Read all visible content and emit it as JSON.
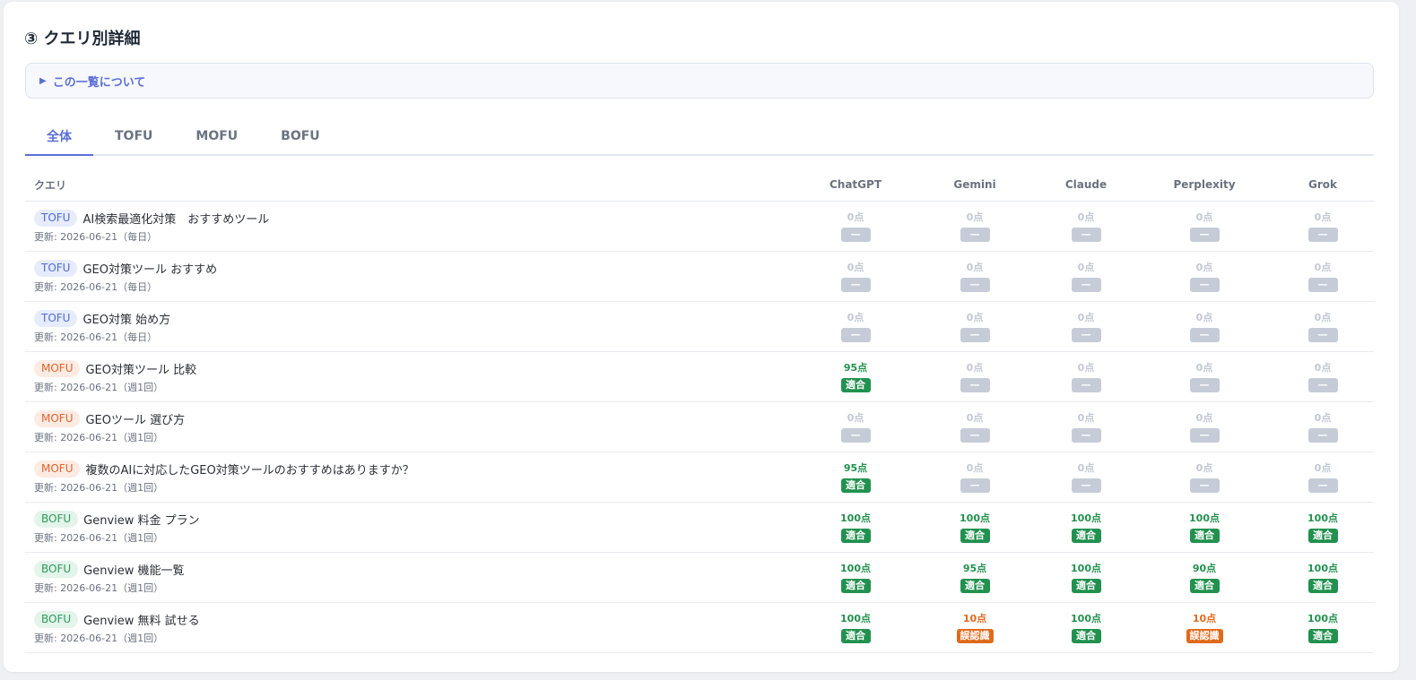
{
  "section": {
    "title": "③ クエリ別詳細"
  },
  "about": {
    "label": "この一覧について"
  },
  "tabs": [
    {
      "label": "全体",
      "active": true
    },
    {
      "label": "TOFU",
      "active": false
    },
    {
      "label": "MOFU",
      "active": false
    },
    {
      "label": "BOFU",
      "active": false
    }
  ],
  "table": {
    "query_header": "クエリ",
    "engines": [
      "ChatGPT",
      "Gemini",
      "Claude",
      "Perplexity",
      "Grok"
    ],
    "rows": [
      {
        "stage": "TOFU",
        "query": "AI検索最適化対策　おすすめツール",
        "updated": "更新: 2026-06-21（毎日）",
        "results": [
          {
            "score": "0点",
            "status": "—",
            "state": "none"
          },
          {
            "score": "0点",
            "status": "—",
            "state": "none"
          },
          {
            "score": "0点",
            "status": "—",
            "state": "none"
          },
          {
            "score": "0点",
            "status": "—",
            "state": "none"
          },
          {
            "score": "0点",
            "status": "—",
            "state": "none"
          }
        ]
      },
      {
        "stage": "TOFU",
        "query": "GEO対策ツール おすすめ",
        "updated": "更新: 2026-06-21（毎日）",
        "results": [
          {
            "score": "0点",
            "status": "—",
            "state": "none"
          },
          {
            "score": "0点",
            "status": "—",
            "state": "none"
          },
          {
            "score": "0点",
            "status": "—",
            "state": "none"
          },
          {
            "score": "0点",
            "status": "—",
            "state": "none"
          },
          {
            "score": "0点",
            "status": "—",
            "state": "none"
          }
        ]
      },
      {
        "stage": "TOFU",
        "query": "GEO対策 始め方",
        "updated": "更新: 2026-06-21（毎日）",
        "results": [
          {
            "score": "0点",
            "status": "—",
            "state": "none"
          },
          {
            "score": "0点",
            "status": "—",
            "state": "none"
          },
          {
            "score": "0点",
            "status": "—",
            "state": "none"
          },
          {
            "score": "0点",
            "status": "—",
            "state": "none"
          },
          {
            "score": "0点",
            "status": "—",
            "state": "none"
          }
        ]
      },
      {
        "stage": "MOFU",
        "query": "GEO対策ツール 比較",
        "updated": "更新: 2026-06-21（週1回）",
        "results": [
          {
            "score": "95点",
            "status": "適合",
            "state": "ok"
          },
          {
            "score": "0点",
            "status": "—",
            "state": "none"
          },
          {
            "score": "0点",
            "status": "—",
            "state": "none"
          },
          {
            "score": "0点",
            "status": "—",
            "state": "none"
          },
          {
            "score": "0点",
            "status": "—",
            "state": "none"
          }
        ]
      },
      {
        "stage": "MOFU",
        "query": "GEOツール 選び方",
        "updated": "更新: 2026-06-21（週1回）",
        "results": [
          {
            "score": "0点",
            "status": "—",
            "state": "none"
          },
          {
            "score": "0点",
            "status": "—",
            "state": "none"
          },
          {
            "score": "0点",
            "status": "—",
            "state": "none"
          },
          {
            "score": "0点",
            "status": "—",
            "state": "none"
          },
          {
            "score": "0点",
            "status": "—",
            "state": "none"
          }
        ]
      },
      {
        "stage": "MOFU",
        "query": "複数のAIに対応したGEO対策ツールのおすすめはありますか？",
        "updated": "更新: 2026-06-21（週1回）",
        "results": [
          {
            "score": "95点",
            "status": "適合",
            "state": "ok"
          },
          {
            "score": "0点",
            "status": "—",
            "state": "none"
          },
          {
            "score": "0点",
            "status": "—",
            "state": "none"
          },
          {
            "score": "0点",
            "status": "—",
            "state": "none"
          },
          {
            "score": "0点",
            "status": "—",
            "state": "none"
          }
        ]
      },
      {
        "stage": "BOFU",
        "query": "Genview 料金 プラン",
        "updated": "更新: 2026-06-21（週1回）",
        "results": [
          {
            "score": "100点",
            "status": "適合",
            "state": "ok"
          },
          {
            "score": "100点",
            "status": "適合",
            "state": "ok"
          },
          {
            "score": "100点",
            "status": "適合",
            "state": "ok"
          },
          {
            "score": "100点",
            "status": "適合",
            "state": "ok"
          },
          {
            "score": "100点",
            "status": "適合",
            "state": "ok"
          }
        ]
      },
      {
        "stage": "BOFU",
        "query": "Genview 機能一覧",
        "updated": "更新: 2026-06-21（週1回）",
        "results": [
          {
            "score": "100点",
            "status": "適合",
            "state": "ok"
          },
          {
            "score": "95点",
            "status": "適合",
            "state": "ok"
          },
          {
            "score": "100点",
            "status": "適合",
            "state": "ok"
          },
          {
            "score": "90点",
            "status": "適合",
            "state": "ok"
          },
          {
            "score": "100点",
            "status": "適合",
            "state": "ok"
          }
        ]
      },
      {
        "stage": "BOFU",
        "query": "Genview 無料 試せる",
        "updated": "更新: 2026-06-21（週1回）",
        "results": [
          {
            "score": "100点",
            "status": "適合",
            "state": "ok"
          },
          {
            "score": "10点",
            "status": "誤認識",
            "state": "bad"
          },
          {
            "score": "100点",
            "status": "適合",
            "state": "ok"
          },
          {
            "score": "10点",
            "status": "誤認識",
            "state": "bad"
          },
          {
            "score": "100点",
            "status": "適合",
            "state": "ok"
          }
        ]
      }
    ]
  }
}
